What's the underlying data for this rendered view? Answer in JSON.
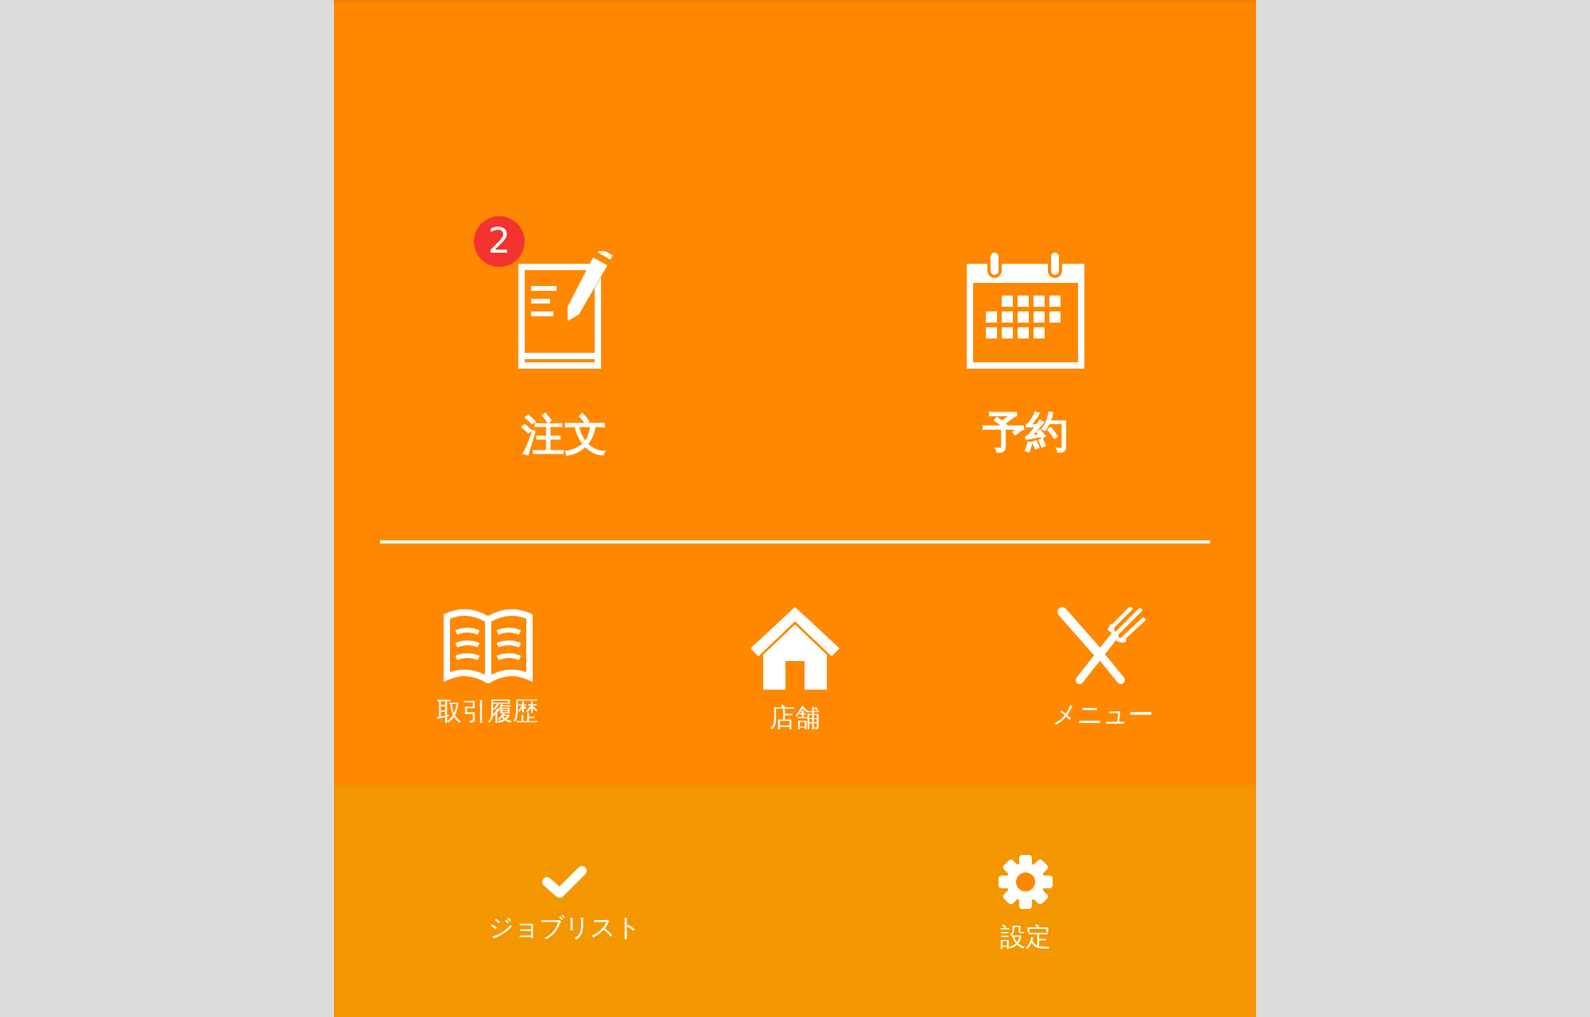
{
  "main_actions": [
    {
      "label": "注文",
      "badge": "2"
    },
    {
      "label": "予約"
    }
  ],
  "sub_actions": [
    {
      "label": "取引履歴"
    },
    {
      "label": "店舗"
    },
    {
      "label": "メニュー"
    }
  ],
  "bottom_nav": [
    {
      "label": "ジョブリスト"
    },
    {
      "label": "設定"
    }
  ]
}
